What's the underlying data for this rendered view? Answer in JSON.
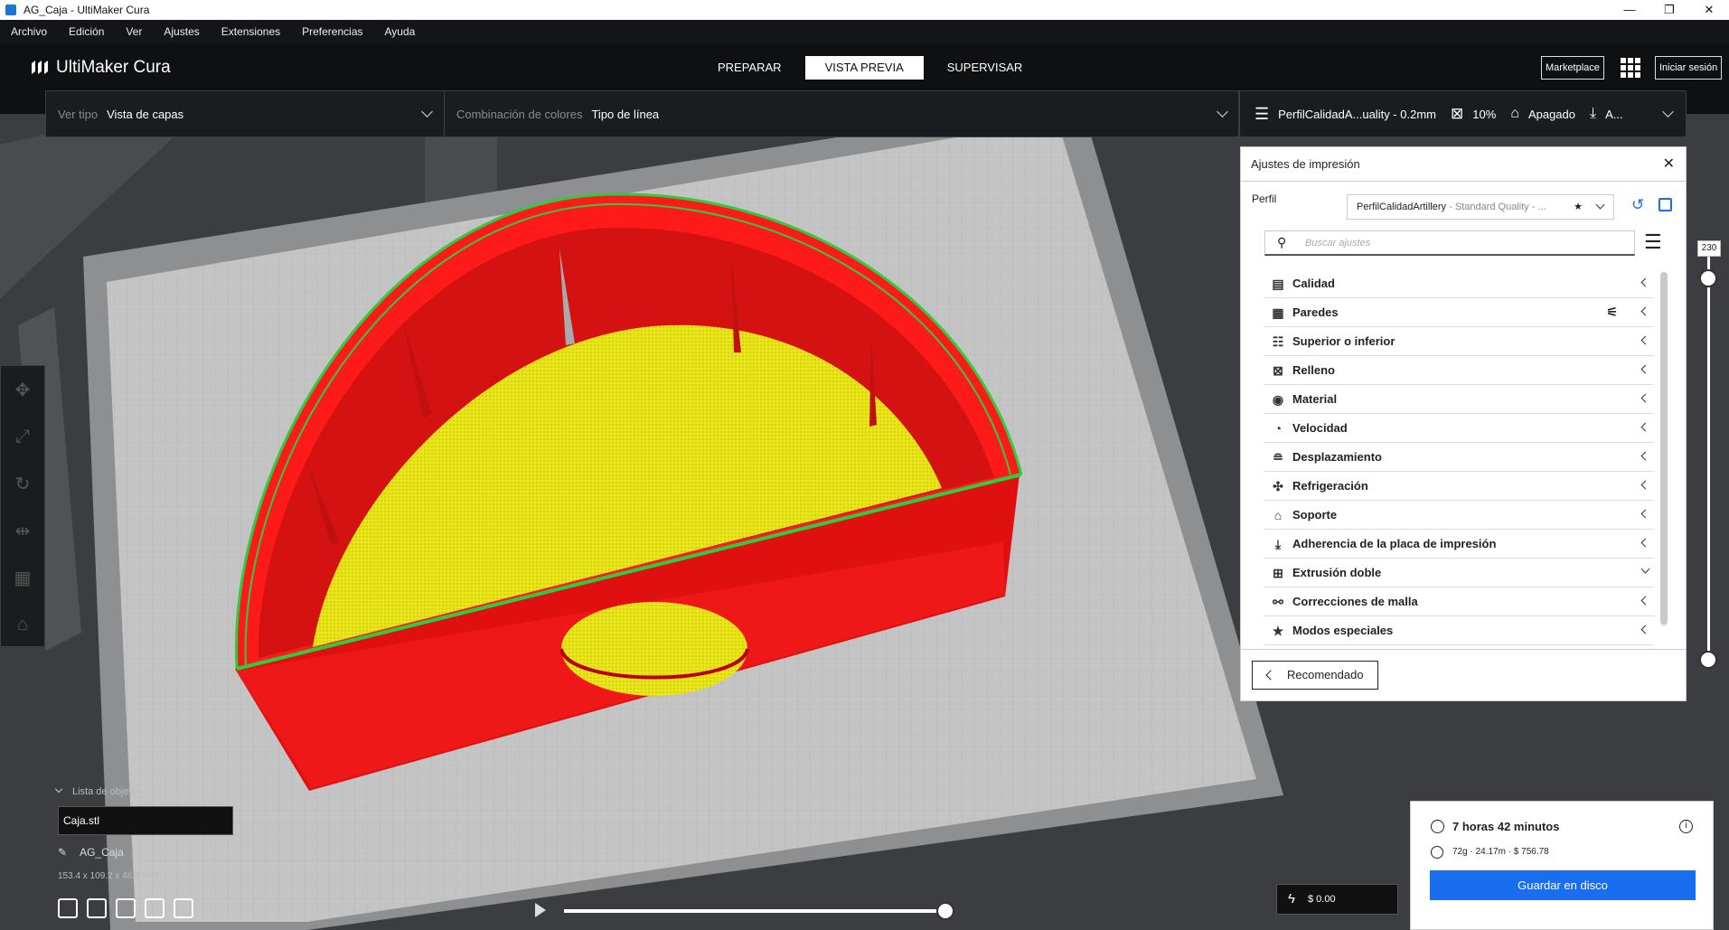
{
  "window": {
    "title": "AG_Caja - UltiMaker Cura",
    "controls": [
      "—",
      "❐",
      "✕"
    ]
  },
  "menu": [
    "Archivo",
    "Edición",
    "Ver",
    "Ajustes",
    "Extensiones",
    "Preferencias",
    "Ayuda"
  ],
  "header": {
    "brand": "UltiMaker Cura",
    "stages": [
      "PREPARAR",
      "VISTA PREVIA",
      "SUPERVISAR"
    ],
    "active_stage": "VISTA PREVIA",
    "marketplace": "Marketplace",
    "signin": "Iniciar sesión"
  },
  "view_bar": {
    "view_type_label": "Ver tipo",
    "view_type_value": "Vista de capas",
    "color_scheme_label": "Combinación de colores",
    "color_scheme_value": "Tipo de línea",
    "profile_short": "PerfilCalidadA...uality - 0.2mm",
    "infill": "10%",
    "support": "Apagado",
    "adhesion": "A..."
  },
  "print_settings": {
    "title": "Ajustes de impresión",
    "profile_label": "Perfil",
    "profile_name": "PerfilCalidadArtillery",
    "profile_suffix": " - Standard Quality - ...",
    "search_placeholder": "Buscar ajustes",
    "categories": [
      {
        "label": "Calidad",
        "icon": "quality-icon"
      },
      {
        "label": "Paredes",
        "icon": "walls-icon"
      },
      {
        "label": "Superior o inferior",
        "icon": "top-bottom-icon"
      },
      {
        "label": "Relleno",
        "icon": "infill-icon"
      },
      {
        "label": "Material",
        "icon": "material-icon"
      },
      {
        "label": "Velocidad",
        "icon": "speed-icon"
      },
      {
        "label": "Desplazamiento",
        "icon": "travel-icon"
      },
      {
        "label": "Refrigeración",
        "icon": "fan-icon"
      },
      {
        "label": "Soporte",
        "icon": "support-icon"
      },
      {
        "label": "Adherencia de la placa de impresión",
        "icon": "adhesion-icon"
      },
      {
        "label": "Extrusión doble",
        "icon": "dual-extrusion-icon"
      },
      {
        "label": "Correcciones de malla",
        "icon": "mesh-fix-icon"
      },
      {
        "label": "Modos especiales",
        "icon": "star-icon"
      }
    ],
    "recommended_button": "Recomendado"
  },
  "layer_slider": {
    "value": "230"
  },
  "object_list": {
    "title": "Lista de objetos",
    "object": "Caja.stl",
    "job_name": "AG_Caja",
    "dimensions": "153.4 x 109.2 x 46.0 mm"
  },
  "playback": {
    "progress": 1.0
  },
  "cost": {
    "value": "$ 0.00"
  },
  "estimate": {
    "time": "7 horas 42 minutos",
    "material": "72g · 24.17m · $ 756.78",
    "save_button": "Guardar en disco"
  },
  "colors": {
    "accent": "#196ef0",
    "wall": "#ff1a1a",
    "infill": "#e8e61a",
    "skin_outline": "#2ecc40",
    "bed": "#c4c4c4"
  }
}
